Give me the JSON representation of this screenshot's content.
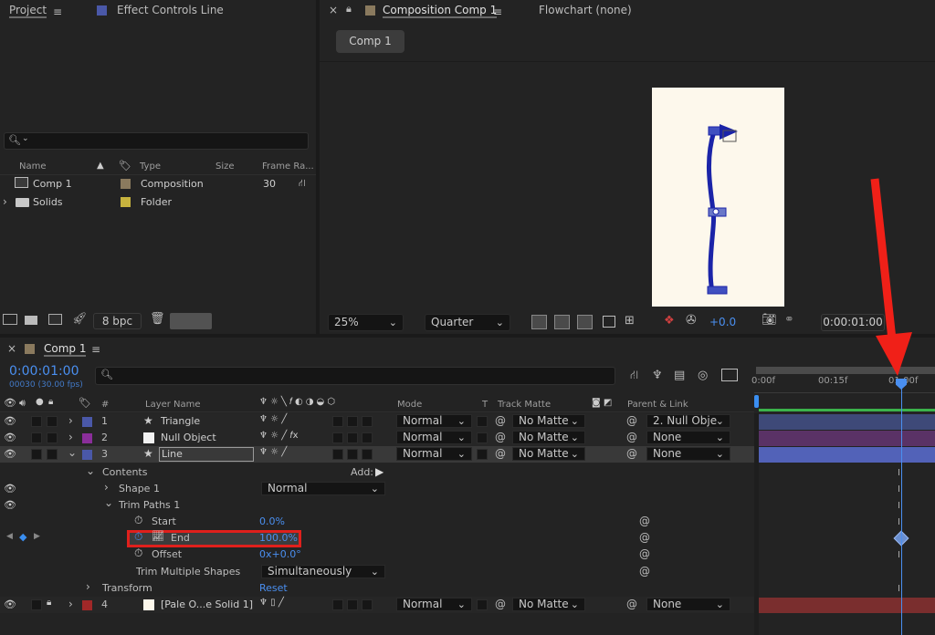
{
  "project_panel": {
    "tab_project": "Project",
    "tab_effect": "Effect Controls Line",
    "search_placeholder": "",
    "columns": {
      "name": "Name",
      "type": "Type",
      "size": "Size",
      "frame_rate": "Frame Ra..."
    },
    "items": [
      {
        "name": "Comp 1",
        "type": "Composition",
        "size": "",
        "fps": "30"
      },
      {
        "name": "Solids",
        "type": "Folder",
        "size": "",
        "fps": ""
      }
    ],
    "bpc": "8 bpc"
  },
  "viewer": {
    "tab_comp": "Composition Comp 1",
    "tab_flowchart": "Flowchart (none)",
    "comp_button": "Comp 1",
    "zoom": "25%",
    "resolution": "Quarter",
    "exposure": "+0.0",
    "timecode": "0:00:01:00"
  },
  "timeline": {
    "comp_tab": "Comp 1",
    "timecode": "0:00:01:00",
    "frame_info": "00030 (30.00 fps)",
    "columns": {
      "num": "#",
      "layer_name": "Layer Name",
      "mode": "Mode",
      "t": "T",
      "track_matte": "Track Matte",
      "parent": "Parent & Link"
    },
    "ruler": [
      "0:00f",
      "00:15f",
      "01:00f"
    ],
    "layers": [
      {
        "num": "1",
        "name": "Triangle",
        "mode": "Normal",
        "matte": "No Matte",
        "parent": "2. Null Obje"
      },
      {
        "num": "2",
        "name": "Null Object",
        "mode": "Normal",
        "matte": "No Matte",
        "parent": "None"
      },
      {
        "num": "3",
        "name": "Line",
        "mode": "Normal",
        "matte": "No Matte",
        "parent": "None"
      },
      {
        "num": "4",
        "name": "[Pale O...e Solid 1]",
        "mode": "Normal",
        "matte": "No Matte",
        "parent": "None"
      }
    ],
    "props": {
      "contents": "Contents",
      "add": "Add:",
      "shape1": "Shape 1",
      "shape1_mode": "Normal",
      "trim_paths": "Trim Paths 1",
      "start": "Start",
      "start_val": "0.0%",
      "end": "End",
      "end_val": "100.0%",
      "offset": "Offset",
      "offset_val": "0x+0.0°",
      "trim_multiple": "Trim Multiple Shapes",
      "trim_multiple_val": "Simultaneously",
      "transform": "Transform",
      "reset": "Reset"
    }
  },
  "colors": {
    "accent_blue": "#4a8ff0",
    "highlight_red": "#e0201c",
    "arrow_red": "#f02018",
    "line_color": "#2a3ab0",
    "canvas_bg": "#fdf8ec"
  }
}
